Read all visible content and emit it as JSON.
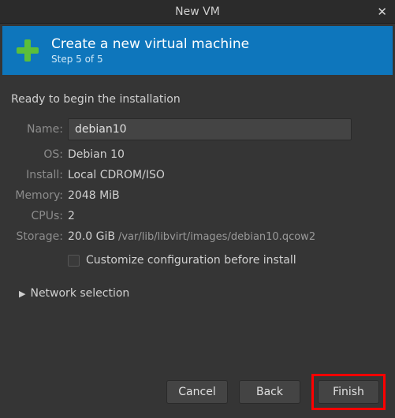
{
  "window": {
    "title": "New VM"
  },
  "banner": {
    "title": "Create a new virtual machine",
    "step": "Step 5 of 5"
  },
  "ready": "Ready to begin the installation",
  "labels": {
    "name": "Name:",
    "os": "OS:",
    "install": "Install:",
    "memory": "Memory:",
    "cpus": "CPUs:",
    "storage": "Storage:"
  },
  "values": {
    "name": "debian10",
    "os": "Debian 10",
    "install": "Local CDROM/ISO",
    "memory": "2048 MiB",
    "cpus": "2",
    "storage_size": "20.0 GiB",
    "storage_path": "/var/lib/libvirt/images/debian10.qcow2"
  },
  "customize": {
    "checked": false,
    "label": "Customize configuration before install"
  },
  "network": {
    "label": "Network selection"
  },
  "buttons": {
    "cancel": "Cancel",
    "back": "Back",
    "finish": "Finish"
  }
}
